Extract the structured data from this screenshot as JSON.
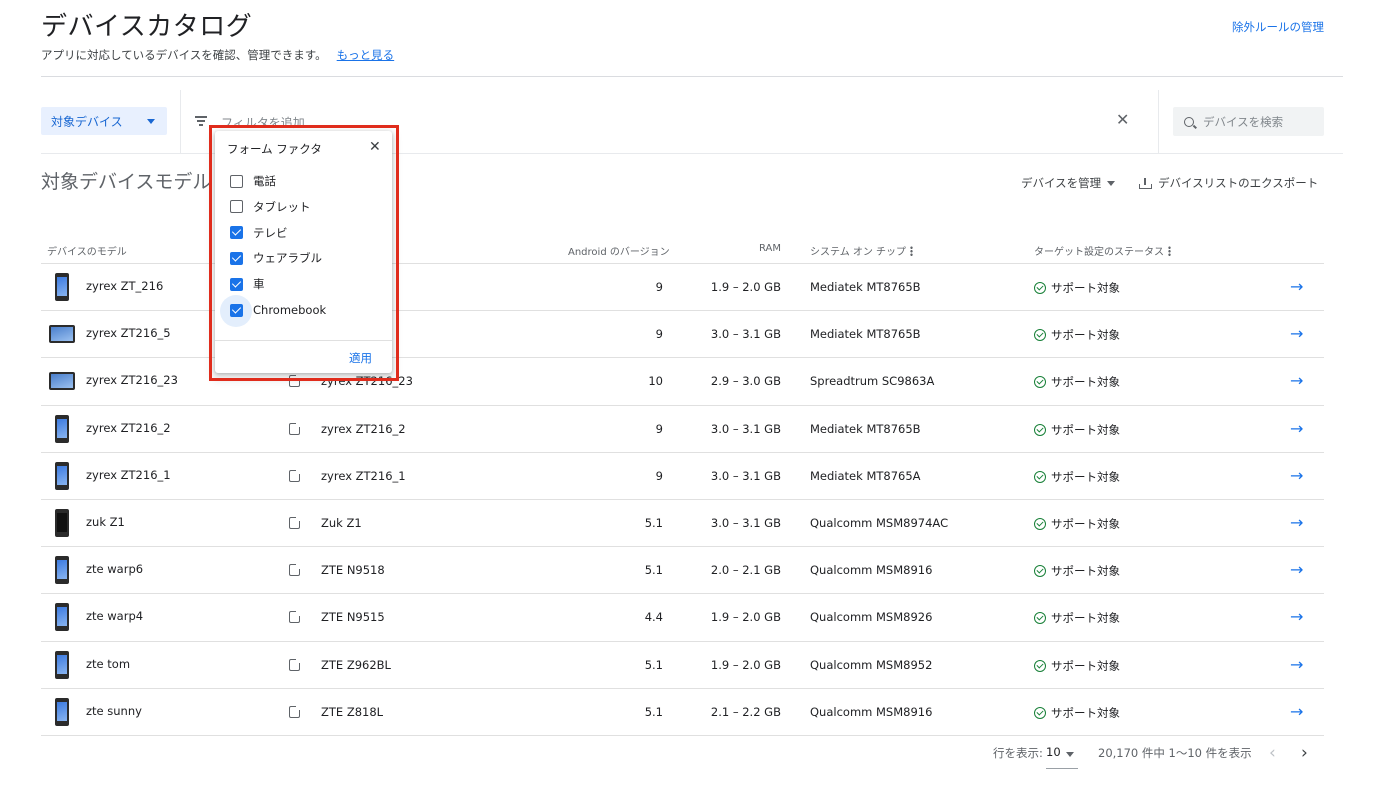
{
  "header": {
    "title": "デバイスカタログ",
    "subtitle": "アプリに対応しているデバイスを確認、管理できます。",
    "learn_more": "もっと見る",
    "exclusion_rules": "除外ルールの管理"
  },
  "filter_bar": {
    "target_devices": "対象デバイス",
    "filter_placeholder": "フィルタを追加",
    "clear_icon": "close-icon",
    "search_placeholder": "デバイスを検索"
  },
  "section": {
    "title": "対象デバイスモデル",
    "manage_devices": "デバイスを管理",
    "export_list": "デバイスリストのエクスポート"
  },
  "table": {
    "headers": {
      "model": "デバイスのモデル",
      "android": "Android のバージョン",
      "ram": "RAM",
      "soc": "システム オン チップ",
      "status": "ターゲット設定のステータス"
    },
    "rows": [
      {
        "model": "zyrex ZT_216",
        "market": "",
        "android": "9",
        "ram": "1.9 – 2.0 GB",
        "soc": "Mediatek MT8765B",
        "status": "サポート対象"
      },
      {
        "model": "zyrex ZT216_5",
        "market": "",
        "android": "9",
        "ram": "3.0 – 3.1 GB",
        "soc": "Mediatek MT8765B",
        "status": "サポート対象"
      },
      {
        "model": "zyrex ZT216_23",
        "market": "zyrex ZT216_23",
        "android": "10",
        "ram": "2.9 – 3.0 GB",
        "soc": "Spreadtrum SC9863A",
        "status": "サポート対象"
      },
      {
        "model": "zyrex ZT216_2",
        "market": "zyrex ZT216_2",
        "android": "9",
        "ram": "3.0 – 3.1 GB",
        "soc": "Mediatek MT8765B",
        "status": "サポート対象"
      },
      {
        "model": "zyrex ZT216_1",
        "market": "zyrex ZT216_1",
        "android": "9",
        "ram": "3.0 – 3.1 GB",
        "soc": "Mediatek MT8765A",
        "status": "サポート対象"
      },
      {
        "model": "zuk Z1",
        "market": "Zuk Z1",
        "android": "5.1",
        "ram": "3.0 – 3.1 GB",
        "soc": "Qualcomm MSM8974AC",
        "status": "サポート対象"
      },
      {
        "model": "zte warp6",
        "market": "ZTE N9518",
        "android": "5.1",
        "ram": "2.0 – 2.1 GB",
        "soc": "Qualcomm MSM8916",
        "status": "サポート対象"
      },
      {
        "model": "zte warp4",
        "market": "ZTE N9515",
        "android": "4.4",
        "ram": "1.9 – 2.0 GB",
        "soc": "Qualcomm MSM8926",
        "status": "サポート対象"
      },
      {
        "model": "zte tom",
        "market": "ZTE Z962BL",
        "android": "5.1",
        "ram": "1.9 – 2.0 GB",
        "soc": "Qualcomm MSM8952",
        "status": "サポート対象"
      },
      {
        "model": "zte sunny",
        "market": "ZTE Z818L",
        "android": "5.1",
        "ram": "2.1 – 2.2 GB",
        "soc": "Qualcomm MSM8916",
        "status": "サポート対象"
      }
    ]
  },
  "pagination": {
    "rows_label": "行を表示:",
    "rows_value": "10",
    "range": "20,170 件中 1〜10 件を表示"
  },
  "popup": {
    "title": "フォーム ファクタ",
    "options": [
      {
        "label": "電話",
        "checked": false
      },
      {
        "label": "タブレット",
        "checked": false
      },
      {
        "label": "テレビ",
        "checked": true
      },
      {
        "label": "ウェアラブル",
        "checked": true
      },
      {
        "label": "車",
        "checked": true
      },
      {
        "label": "Chromebook",
        "checked": true
      }
    ],
    "apply": "適用"
  },
  "colors": {
    "accent": "#1a73e8",
    "success": "#188038",
    "highlight_border": "#e02c1c"
  }
}
